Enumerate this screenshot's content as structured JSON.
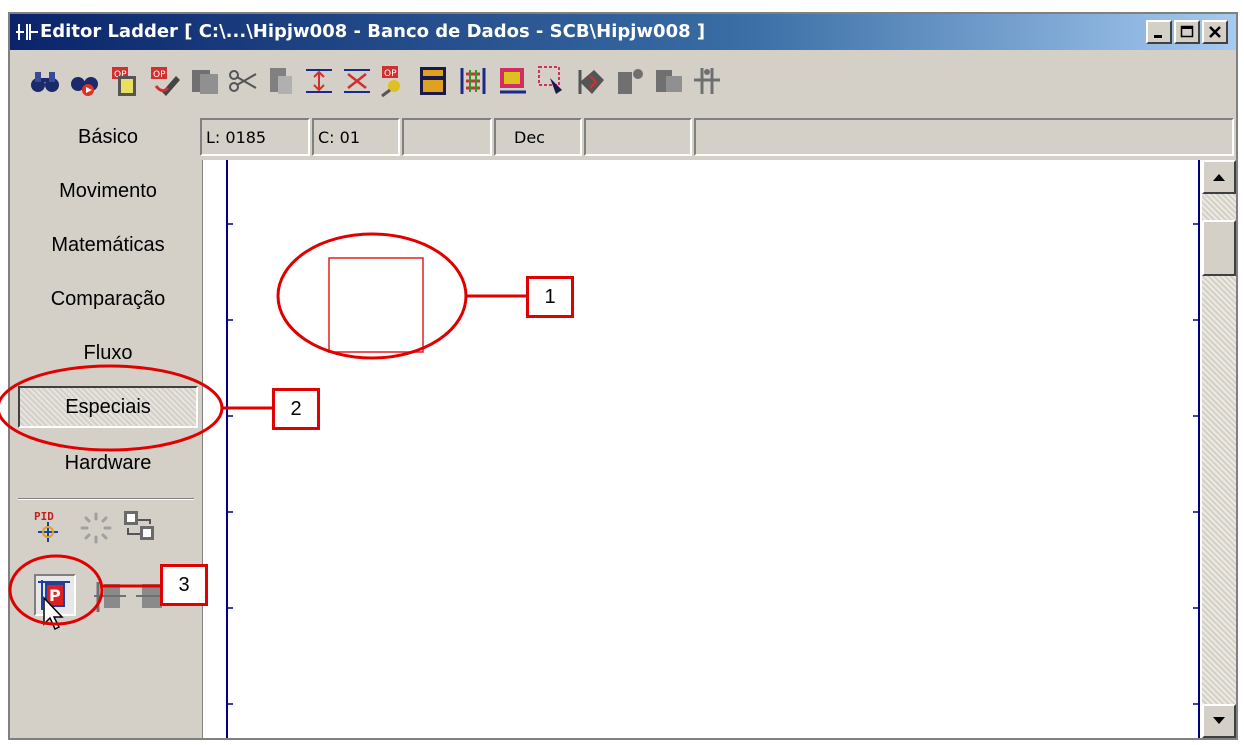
{
  "window": {
    "title": "Editor Ladder [ C:\\...\\Hipjw008 - Banco de Dados - SCB\\Hipjw008 ]"
  },
  "toolbar": {
    "icons": [
      "binoculars-icon",
      "find-next-icon",
      "op-document-icon",
      "op-edit-icon",
      "copy-icon",
      "cut-icon",
      "paste-icon",
      "insert-line-icon",
      "delete-line-icon",
      "op-search-icon",
      "calculator-icon",
      "online-compare-icon",
      "transfer-icon",
      "check-icon",
      "verify-icon",
      "plc-transfer-icon",
      "download-icon",
      "ladder-logic-icon"
    ]
  },
  "sidebar": {
    "items": [
      {
        "label": "Básico"
      },
      {
        "label": "Movimento"
      },
      {
        "label": "Matemáticas"
      },
      {
        "label": "Comparação"
      },
      {
        "label": "Fluxo"
      },
      {
        "label": "Especiais",
        "active": true
      },
      {
        "label": "Hardware"
      }
    ],
    "tools": [
      {
        "name": "pid-icon",
        "label": "PID"
      },
      {
        "name": "scan-cycle-icon"
      },
      {
        "name": "data-transfer-icon"
      },
      {
        "name": "parameter-block-icon",
        "label": "P"
      },
      {
        "name": "block-icon-1"
      },
      {
        "name": "block-icon-2"
      }
    ]
  },
  "status": {
    "line": "L: 0185",
    "column": "C: 01",
    "field3": "",
    "base": "Dec",
    "field5": "",
    "field6": ""
  },
  "callouts": [
    "1",
    "2",
    "3"
  ],
  "colors": {
    "title_start": "#0a246a",
    "title_end": "#a6caf0",
    "highlight": "#e00000",
    "ladder_rail": "#000080"
  }
}
